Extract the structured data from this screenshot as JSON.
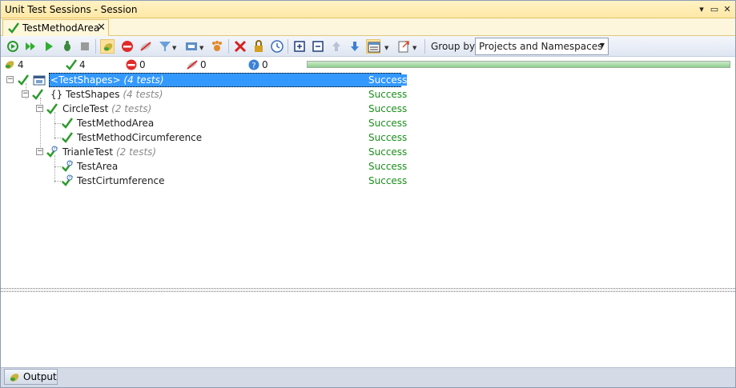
{
  "window": {
    "title": "Unit Test Sessions - Session",
    "controls": [
      "dropdown-arrow-icon",
      "maximize-icon",
      "close-icon"
    ]
  },
  "tab": {
    "label": "TestMethodArea",
    "close": "✕"
  },
  "toolbar": {
    "group_by_label": "Group by:",
    "group_by_value": "Projects and Namespaces",
    "icons": [
      "run-all-icon",
      "run-icon",
      "debug-icon",
      "stop-icon",
      "show-passed-icon",
      "show-failed-icon",
      "show-ignored-icon",
      "filter-icon",
      "build-settings-icon",
      "profile-icon",
      "remove-icon",
      "lock-icon",
      "timeout-icon",
      "expand-all-icon",
      "collapse-all-icon",
      "previous-icon",
      "next-icon",
      "layout-icon",
      "export-icon"
    ]
  },
  "status": {
    "total": "4",
    "passed": "4",
    "failed": "0",
    "ignored": "0",
    "unknown": "0",
    "progress": 1.0
  },
  "tree": [
    {
      "label": "<TestShapes>",
      "count": "(4 tests)",
      "result": "Success",
      "level": 0,
      "selected": true
    },
    {
      "label": "{} TestShapes",
      "count": "(4 tests)",
      "result": "Success",
      "level": 1
    },
    {
      "label": "CircleTest",
      "count": "(2 tests)",
      "result": "Success",
      "level": 2
    },
    {
      "label": "TestMethodArea",
      "count": "",
      "result": "Success",
      "level": 3
    },
    {
      "label": "TestMethodCircumference",
      "count": "",
      "result": "Success",
      "level": 3
    },
    {
      "label": "TrianleTest",
      "count": "(2 tests)",
      "result": "Success",
      "level": 2
    },
    {
      "label": "TestArea",
      "count": "",
      "result": "Success",
      "level": 3
    },
    {
      "label": "TestCirtumference",
      "count": "",
      "result": "Success",
      "level": 3
    }
  ],
  "bottom": {
    "output_tab": "Output"
  },
  "colors": {
    "success": "#1a8f1a",
    "selection": "#3399ff",
    "titlebar": "#ffe8a6"
  }
}
